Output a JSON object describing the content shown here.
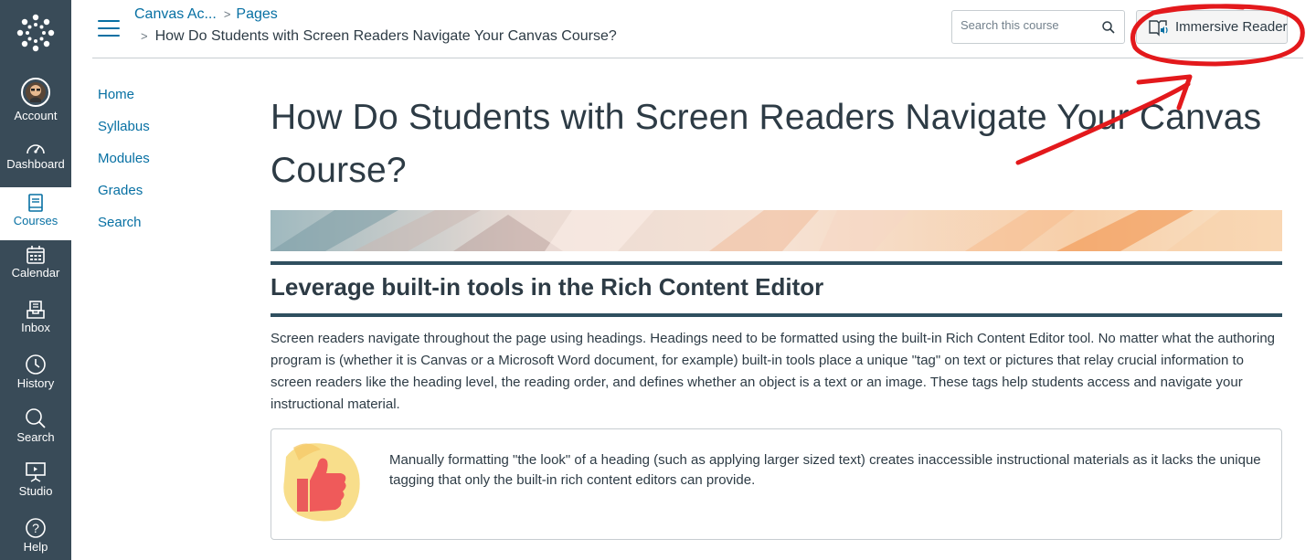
{
  "nav": {
    "items": [
      {
        "label": "Account",
        "icon": "avatar"
      },
      {
        "label": "Dashboard",
        "icon": "speedometer-icon"
      },
      {
        "label": "Courses",
        "icon": "book-icon"
      },
      {
        "label": "Calendar",
        "icon": "calendar-icon"
      },
      {
        "label": "Inbox",
        "icon": "inbox-icon"
      },
      {
        "label": "History",
        "icon": "clock-icon"
      },
      {
        "label": "Search",
        "icon": "search-icon"
      },
      {
        "label": "Studio",
        "icon": "studio-icon"
      },
      {
        "label": "Help",
        "icon": "question-icon"
      }
    ],
    "active": "Courses",
    "bg_color": "#394b58",
    "active_color": "#0770a3"
  },
  "header": {
    "breadcrumb_course": "Canvas Ac...",
    "breadcrumb_section": "Pages",
    "breadcrumb_page": "How Do Students with Screen Readers Navigate Your Canvas Course?",
    "search_placeholder": "Search this course",
    "immersive_reader_label": "Immersive Reader"
  },
  "course_nav": [
    "Home",
    "Syllabus",
    "Modules",
    "Grades",
    "Search"
  ],
  "content": {
    "title": "How Do Students with Screen Readers Navigate Your Canvas Course?",
    "heading": "Leverage built-in tools in the Rich Content Editor",
    "paragraph": "Screen readers navigate throughout the page using headings. Headings need to be formatted using the built-in Rich Content Editor tool. No matter what the authoring program is (whether it is Canvas or a Microsoft Word document, for example) built-in tools place a unique \"tag\" on text or pictures that relay crucial information to screen readers like the heading level, the reading order, and defines whether an object is a text or an image. These tags help students access and navigate your instructional material.",
    "callout": "Manually formatting \"the look\" of a heading (such as applying larger sized text) creates inaccessible instructional materials as it lacks the unique tagging that only the built-in rich content editors can provide.",
    "callout_icon": "thumbs-up-icon"
  },
  "colors": {
    "link": "#0770a3",
    "heading_rule": "#2f4f5f",
    "annotation": "#e3191c"
  }
}
